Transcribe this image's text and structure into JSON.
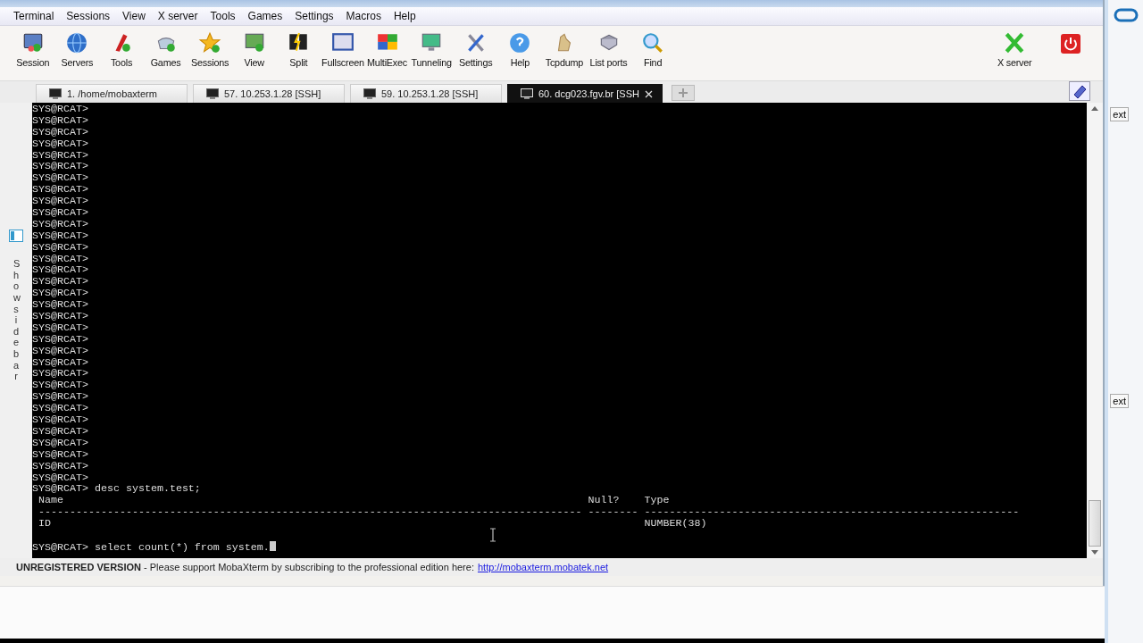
{
  "menu": [
    "Terminal",
    "Sessions",
    "View",
    "X server",
    "Tools",
    "Games",
    "Settings",
    "Macros",
    "Help"
  ],
  "toolbar": [
    {
      "label": "Session"
    },
    {
      "label": "Servers"
    },
    {
      "label": "Tools"
    },
    {
      "label": "Games"
    },
    {
      "label": "Sessions"
    },
    {
      "label": "View"
    },
    {
      "label": "Split"
    },
    {
      "label": "Fullscreen"
    },
    {
      "label": "MultiExec"
    },
    {
      "label": "Tunneling"
    },
    {
      "label": "Settings"
    },
    {
      "label": "Help"
    },
    {
      "label": "Tcpdump"
    },
    {
      "label": "List ports"
    },
    {
      "label": "Find"
    }
  ],
  "toolbar_right": {
    "label": "X server"
  },
  "tabs": [
    {
      "label": "1. /home/mobaxterm",
      "selected": false
    },
    {
      "label": "57. 10.253.1.28 [SSH]",
      "selected": false
    },
    {
      "label": "59. 10.253.1.28 [SSH]",
      "selected": false
    },
    {
      "label": "60. dcg023.fgv.br [SSH",
      "selected": true
    }
  ],
  "sidebar_toggle": {
    "label": "Show sidebar"
  },
  "terminal": {
    "lines": [
      "SYS@RCAT>",
      "SYS@RCAT>",
      "SYS@RCAT>",
      "SYS@RCAT>",
      "SYS@RCAT>",
      "SYS@RCAT>",
      "SYS@RCAT>",
      "SYS@RCAT>",
      "SYS@RCAT>",
      "SYS@RCAT>",
      "SYS@RCAT>",
      "SYS@RCAT>",
      "SYS@RCAT>",
      "SYS@RCAT>",
      "SYS@RCAT>",
      "SYS@RCAT>",
      "SYS@RCAT>",
      "SYS@RCAT>",
      "SYS@RCAT>",
      "SYS@RCAT>",
      "SYS@RCAT>",
      "SYS@RCAT>",
      "SYS@RCAT>",
      "SYS@RCAT>",
      "SYS@RCAT>",
      "SYS@RCAT>",
      "SYS@RCAT>",
      "SYS@RCAT>",
      "SYS@RCAT>",
      "SYS@RCAT>",
      "SYS@RCAT>",
      "SYS@RCAT>",
      "SYS@RCAT>",
      "SYS@RCAT> desc system.test;",
      " Name                                                                                    Null?    Type",
      " --------------------------------------------------------------------------------------- -------- ------------------------------------------------------------",
      " ID                                                                                               NUMBER(38)"
    ],
    "input_line": "SYS@RCAT> select count(*) from system."
  },
  "status_bar": {
    "text": "**UNREGISTERED VERSION** - Please support MobaXterm by subscribing to the professional edition here:",
    "link": "http://mobaxterm.mobatek.net"
  },
  "background_window": {
    "buttons": [
      "ext",
      "ext"
    ]
  }
}
